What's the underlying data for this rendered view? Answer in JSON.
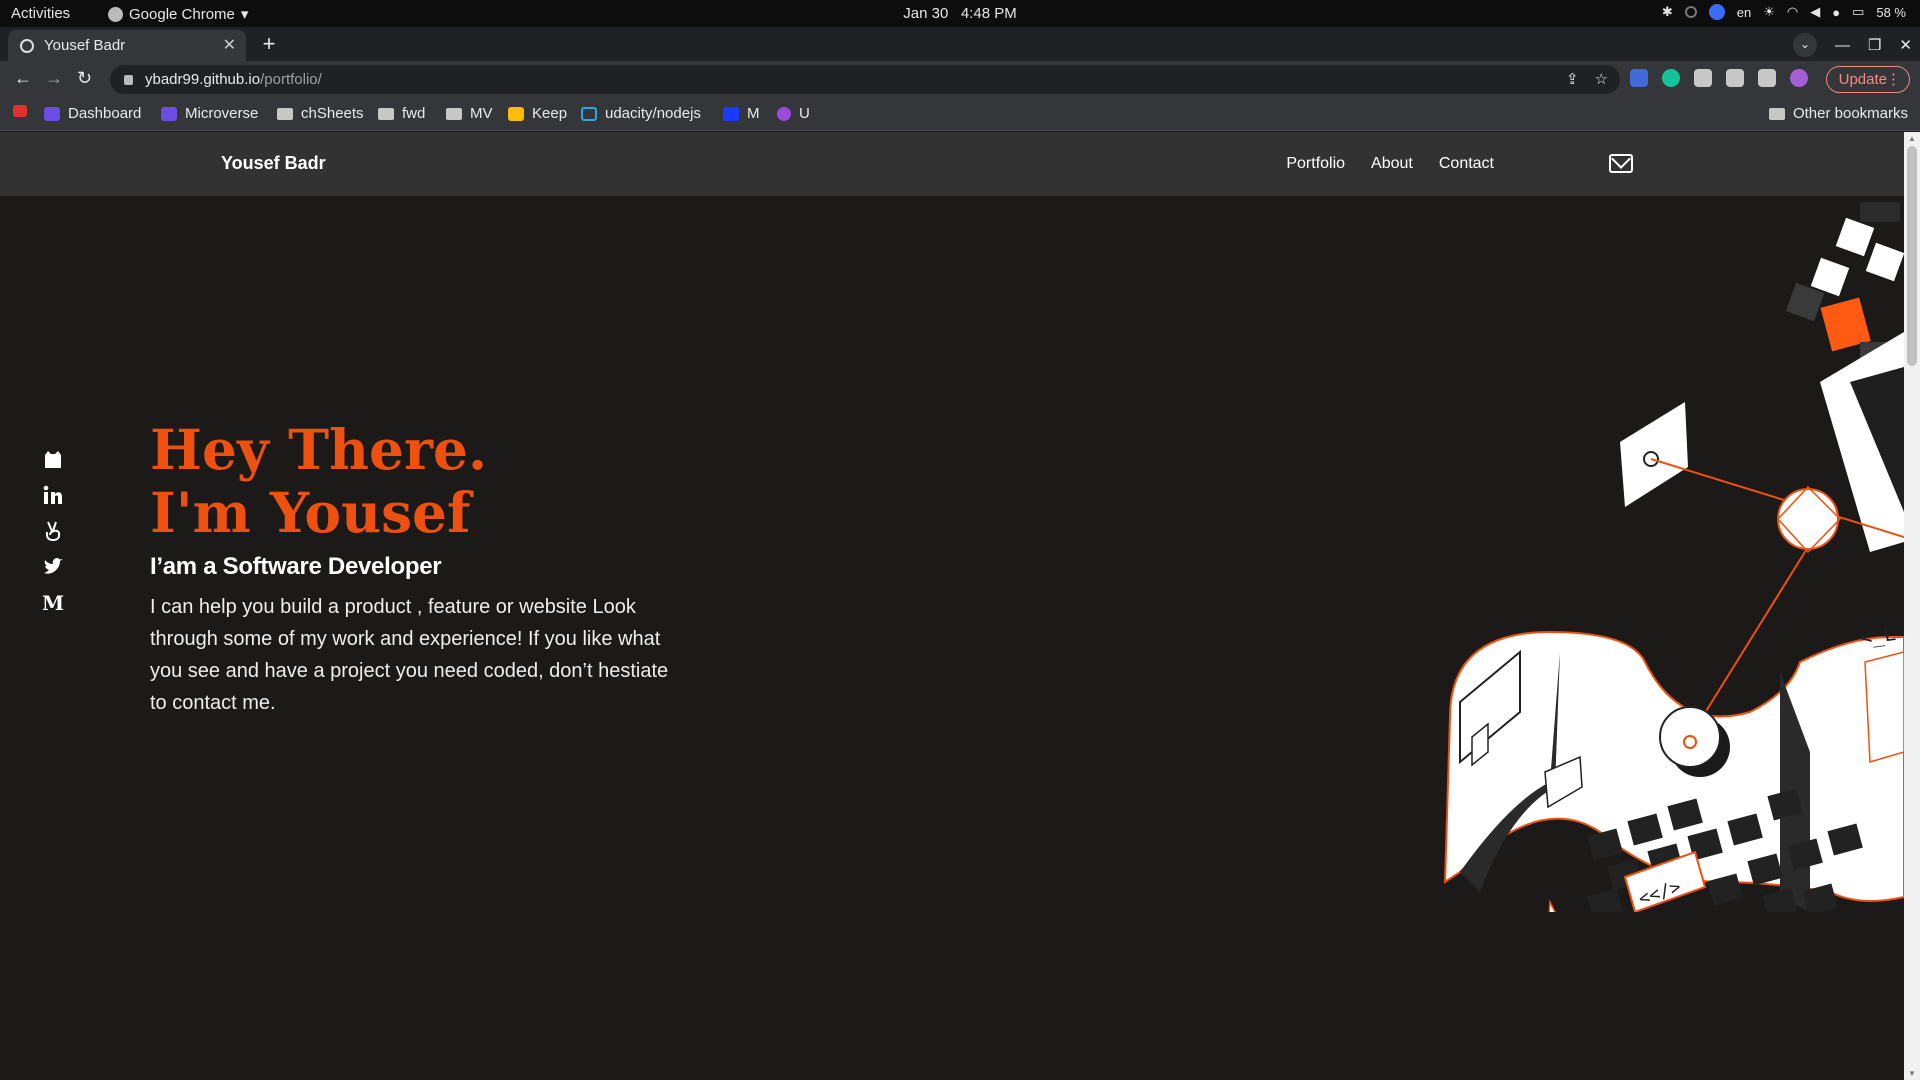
{
  "os": {
    "activities": "Activities",
    "app_name": "Google Chrome",
    "date": "Jan 30",
    "time": "4:48 PM",
    "lang": "en",
    "battery": "58 %"
  },
  "browser": {
    "tab_title": "Yousef Badr",
    "url_host": "ybadr99.github.io",
    "url_path": "/portfolio/",
    "update_label": "Update",
    "bookmarks": [
      {
        "label": "Dashboard"
      },
      {
        "label": "Microverse"
      },
      {
        "label": "chSheets"
      },
      {
        "label": "fwd"
      },
      {
        "label": "MV"
      },
      {
        "label": "Keep"
      },
      {
        "label": "udacity/nodejs"
      },
      {
        "label": "M"
      },
      {
        "label": "U"
      }
    ],
    "other_bookmarks": "Other bookmarks"
  },
  "site": {
    "brand": "Yousef Badr",
    "nav": [
      "Portfolio",
      "About",
      "Contact"
    ],
    "socials": [
      "github-icon",
      "linkedin-icon",
      "angellist-icon",
      "twitter-icon",
      "medium-icon"
    ],
    "hero": {
      "title": "Hey There. I'm Yousef",
      "subtitle": "I’am a Software Developer",
      "text": "I can help you build a product , feature or website Look through some of my work and experience! If you like what you see and have a project you need coded, don’t hestiate to contact me."
    },
    "illustration": {
      "code_tag_1": "<_L",
      "code_tag_2": "<</>"
    }
  },
  "colors": {
    "accent": "#ee500f",
    "page_bg": "#1b1a19",
    "header_bg": "#323232"
  }
}
